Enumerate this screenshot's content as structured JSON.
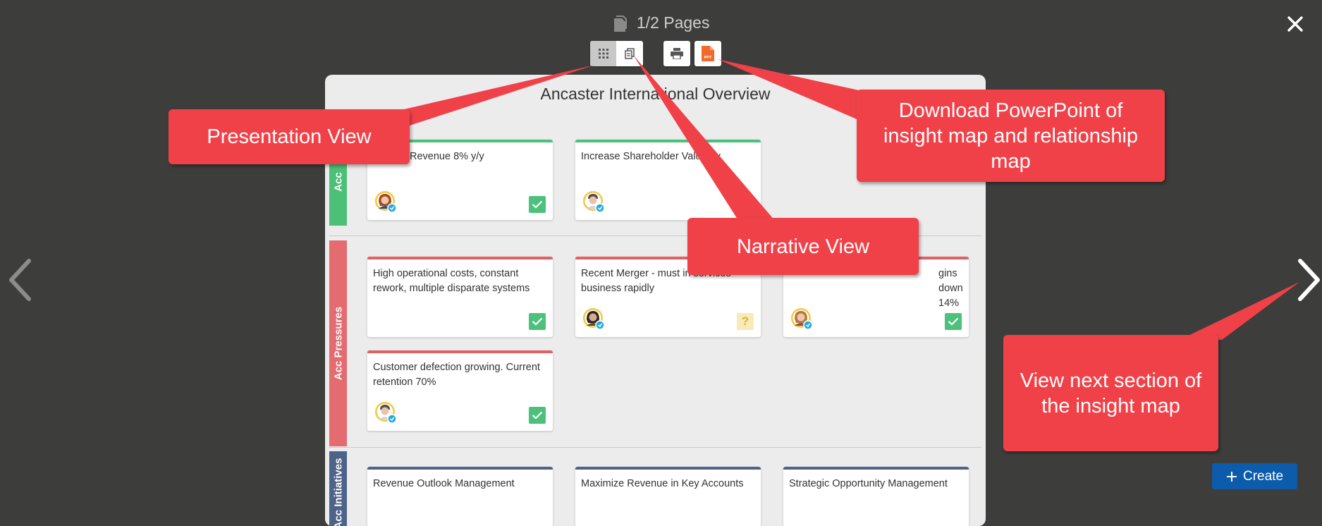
{
  "pager": {
    "label": "1/2 Pages"
  },
  "toolbar": {
    "presentation_view_icon": "grid-icon",
    "narrative_view_icon": "copy-pages-icon",
    "print_icon": "printer-icon",
    "ppt_icon": "ppt-file-icon",
    "ppt_text": "PPT"
  },
  "board": {
    "title": "Ancaster International Overview",
    "lanes": [
      {
        "label": "Acc",
        "color": "#4cc078"
      },
      {
        "label": "Acc Pressures",
        "color": "#e35f63"
      },
      {
        "label": "Acc Initiatives",
        "color": "#4e6389"
      }
    ],
    "cards": [
      {
        "text": "Revenue 8% y/y",
        "status": "check"
      },
      {
        "text": "Increase Shareholder Value by",
        "status": "check"
      },
      {
        "text": "High operational costs, constant rework, multiple disparate systems",
        "status": "check"
      },
      {
        "text": "Recent Merger - must in services business rapidly",
        "status": "question",
        "status_text": "?"
      },
      {
        "text": "gins down 14%",
        "status": "check"
      },
      {
        "text": "Customer defection growing. Current retention 70%",
        "status": "check"
      },
      {
        "text": "Revenue Outlook Management"
      },
      {
        "text": "Maximize Revenue in Key Accounts"
      },
      {
        "text": "Strategic Opportunity Management"
      }
    ]
  },
  "callouts": {
    "presentation": "Presentation View",
    "narrative": "Narrative View",
    "download": "Download PowerPoint of insight map and relationship map",
    "next_section": "View next section of the insight map"
  },
  "create_button": {
    "label": "Create"
  },
  "colors": {
    "background": "#3d3d3b",
    "callout": "#f04149",
    "create": "#0c5cab",
    "check": "#4dc17c"
  }
}
